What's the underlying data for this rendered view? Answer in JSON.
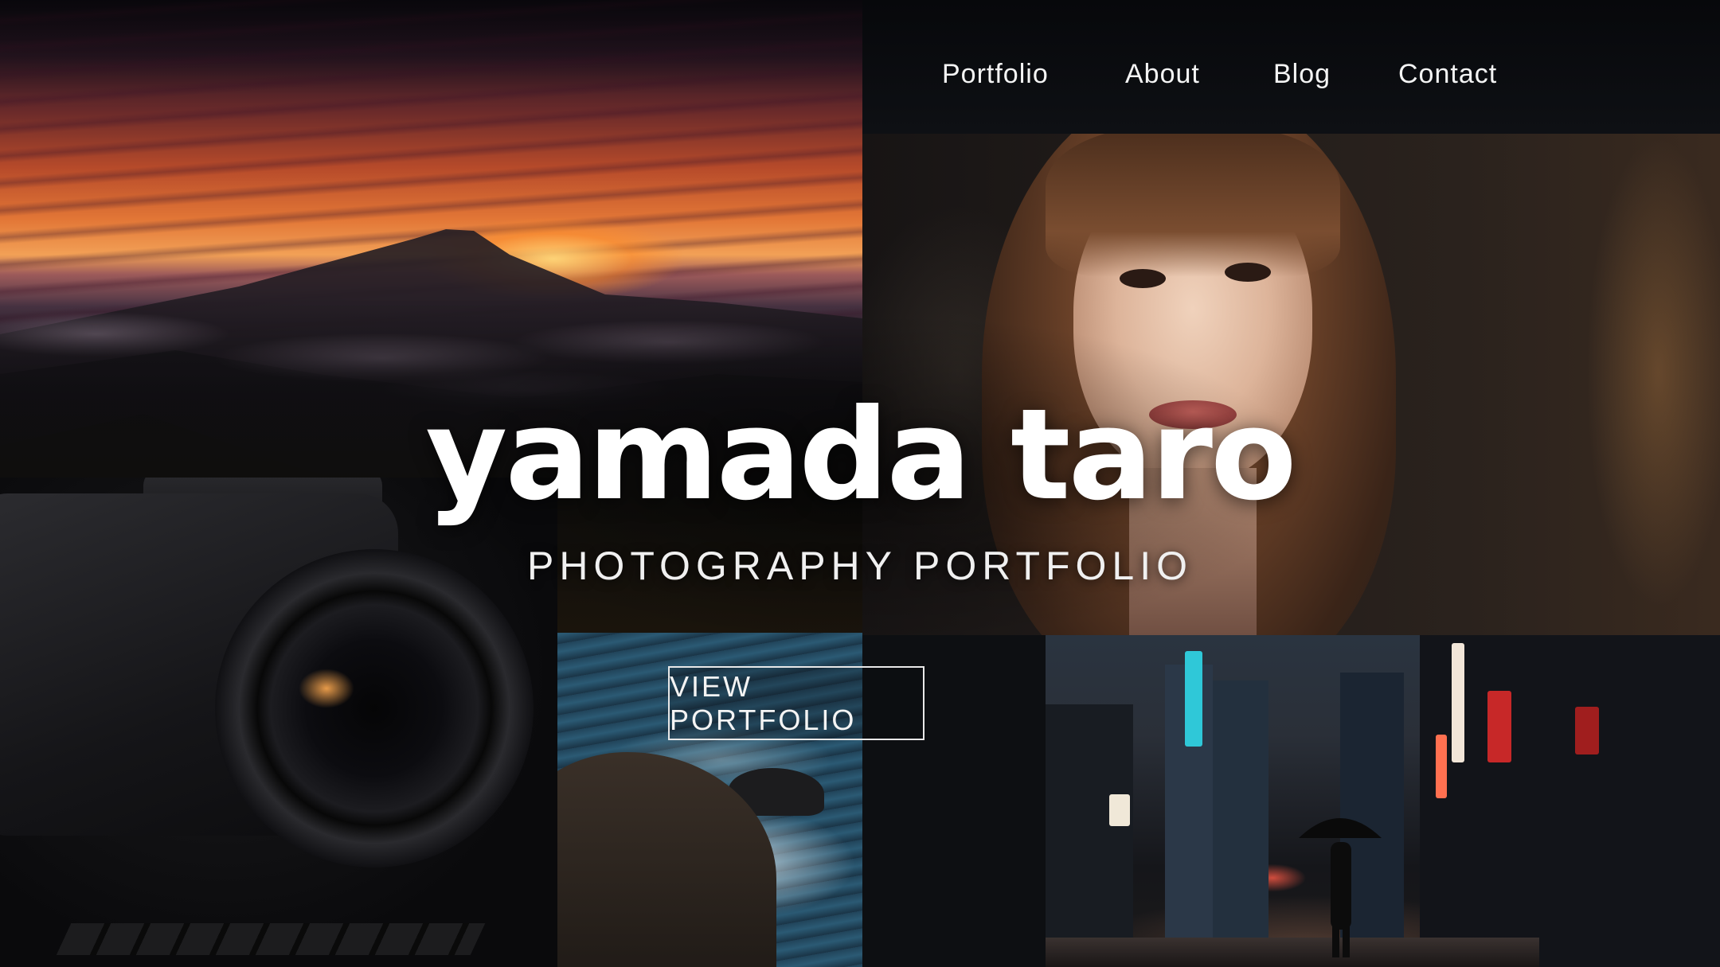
{
  "nav": {
    "items": [
      {
        "label": "Portfolio"
      },
      {
        "label": "About"
      },
      {
        "label": "Blog"
      },
      {
        "label": "Contact"
      }
    ]
  },
  "hero": {
    "title": "yamada taro",
    "subtitle": "PHOTOGRAPHY PORTFOLIO",
    "cta_label": "VIEW PORTFOLIO"
  },
  "images": [
    {
      "name": "mountain-sunset-photo"
    },
    {
      "name": "portrait-photo"
    },
    {
      "name": "ocean-rocks-photo"
    },
    {
      "name": "night-city-street-photo"
    },
    {
      "name": "camera-photo"
    }
  ],
  "colors": {
    "background": "#0b0c10",
    "text": "#ffffff",
    "button_border": "#e8e8e8"
  }
}
